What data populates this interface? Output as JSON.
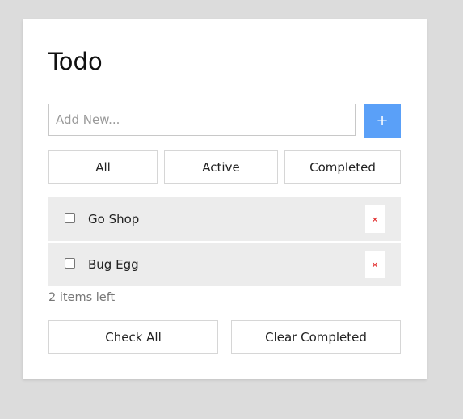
{
  "header": {
    "title": "Todo"
  },
  "new_todo": {
    "placeholder": "Add New...",
    "value": "",
    "add_label": "+"
  },
  "filters": [
    {
      "label": "All"
    },
    {
      "label": "Active"
    },
    {
      "label": "Completed"
    }
  ],
  "todos": [
    {
      "label": "Go Shop",
      "checked": false,
      "delete_label": "×"
    },
    {
      "label": "Bug Egg",
      "checked": false,
      "delete_label": "×"
    }
  ],
  "footer": {
    "items_left": "2 items left",
    "check_all_label": "Check All",
    "clear_completed_label": "Clear Completed"
  },
  "colors": {
    "accent": "#5aa0f8",
    "delete": "#e02020",
    "item_background": "#ececec",
    "page_background": "#dcdcdc"
  }
}
